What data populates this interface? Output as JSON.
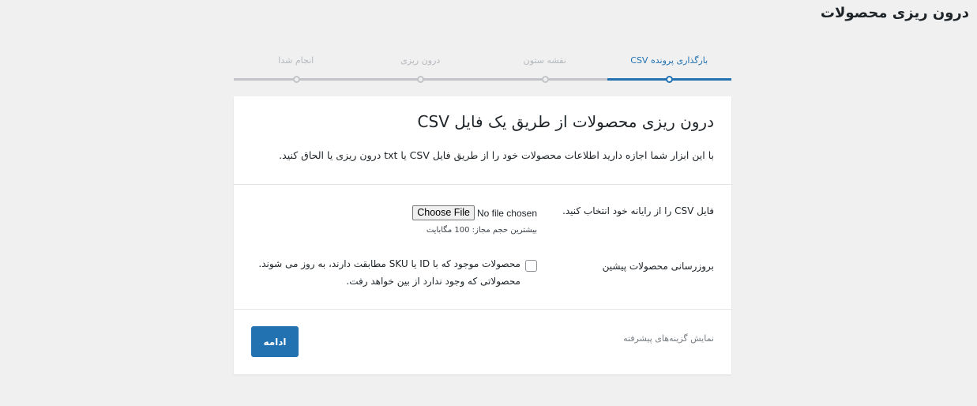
{
  "page": {
    "title": "درون ریزی محصولات"
  },
  "steps": [
    {
      "label": "بارگذاری پرونده CSV",
      "active": true
    },
    {
      "label": "نقشه ستون",
      "active": false
    },
    {
      "label": "درون ریزی",
      "active": false
    },
    {
      "label": "انجام شدا",
      "active": false
    }
  ],
  "card": {
    "title": "درون ریزی محصولات از طریق یک فایل CSV",
    "description": "با این ابزار شما اجازه دارید اطلاعات محصولات خود را از طریق فایل CSV یا txt درون ریزی یا الحاق کنید."
  },
  "file_field": {
    "label": "فایل CSV را از رایانه خود انتخاب کنید.",
    "button_label": "Choose File",
    "status": "No file chosen",
    "hint": "بیشترین حجم مجاز: 100 مگابایت"
  },
  "update_field": {
    "label": "بروزرسانی محصولات پیشین",
    "checked": false,
    "text": "محصولات موجود که با ID یا SKU مطابقت دارند، به روز می شوند. محصولاتی که وجود ندارد از بین خواهد رفت."
  },
  "footer": {
    "advanced_label": "نمایش گزینه‌های پیشرفته",
    "continue_label": "ادامه"
  },
  "colors": {
    "accent": "#2271b1",
    "background": "#f0f0f1",
    "inactive_step": "#c3c4c7"
  }
}
